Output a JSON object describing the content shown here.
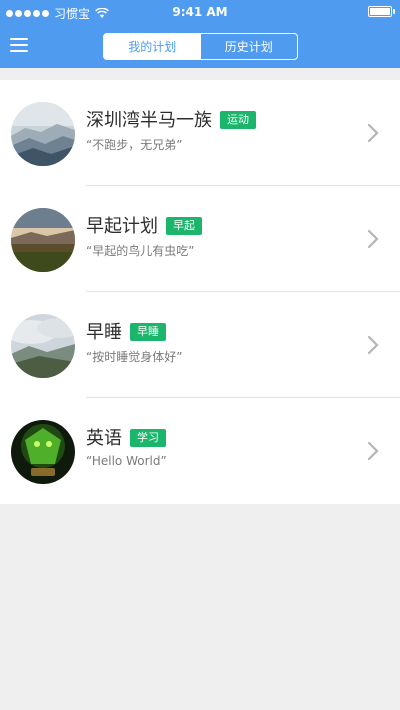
{
  "status_bar": {
    "carrier": "习惯宝",
    "time": "9:41 AM"
  },
  "header": {
    "tabs": [
      {
        "label": "我的计划",
        "active": true
      },
      {
        "label": "历史计划",
        "active": false
      }
    ]
  },
  "colors": {
    "brand": "#4e9bf0",
    "tag": "#1bb66b"
  },
  "plans": [
    {
      "title": "深圳湾半马一族",
      "tag": "运动",
      "quote": "“不跑步，无兄弟”",
      "avatar": "mountain-landscape-image"
    },
    {
      "title": "早起计划",
      "tag": "早起",
      "quote": "“早起的鸟儿有虫吃”",
      "avatar": "sunrise-field-image"
    },
    {
      "title": "早睡",
      "tag": "早睡",
      "quote": "“按时睡觉身体好”",
      "avatar": "cloudy-hills-image"
    },
    {
      "title": "英语",
      "tag": "学习",
      "quote": "“Hello World”",
      "avatar": "game-character-image"
    }
  ]
}
